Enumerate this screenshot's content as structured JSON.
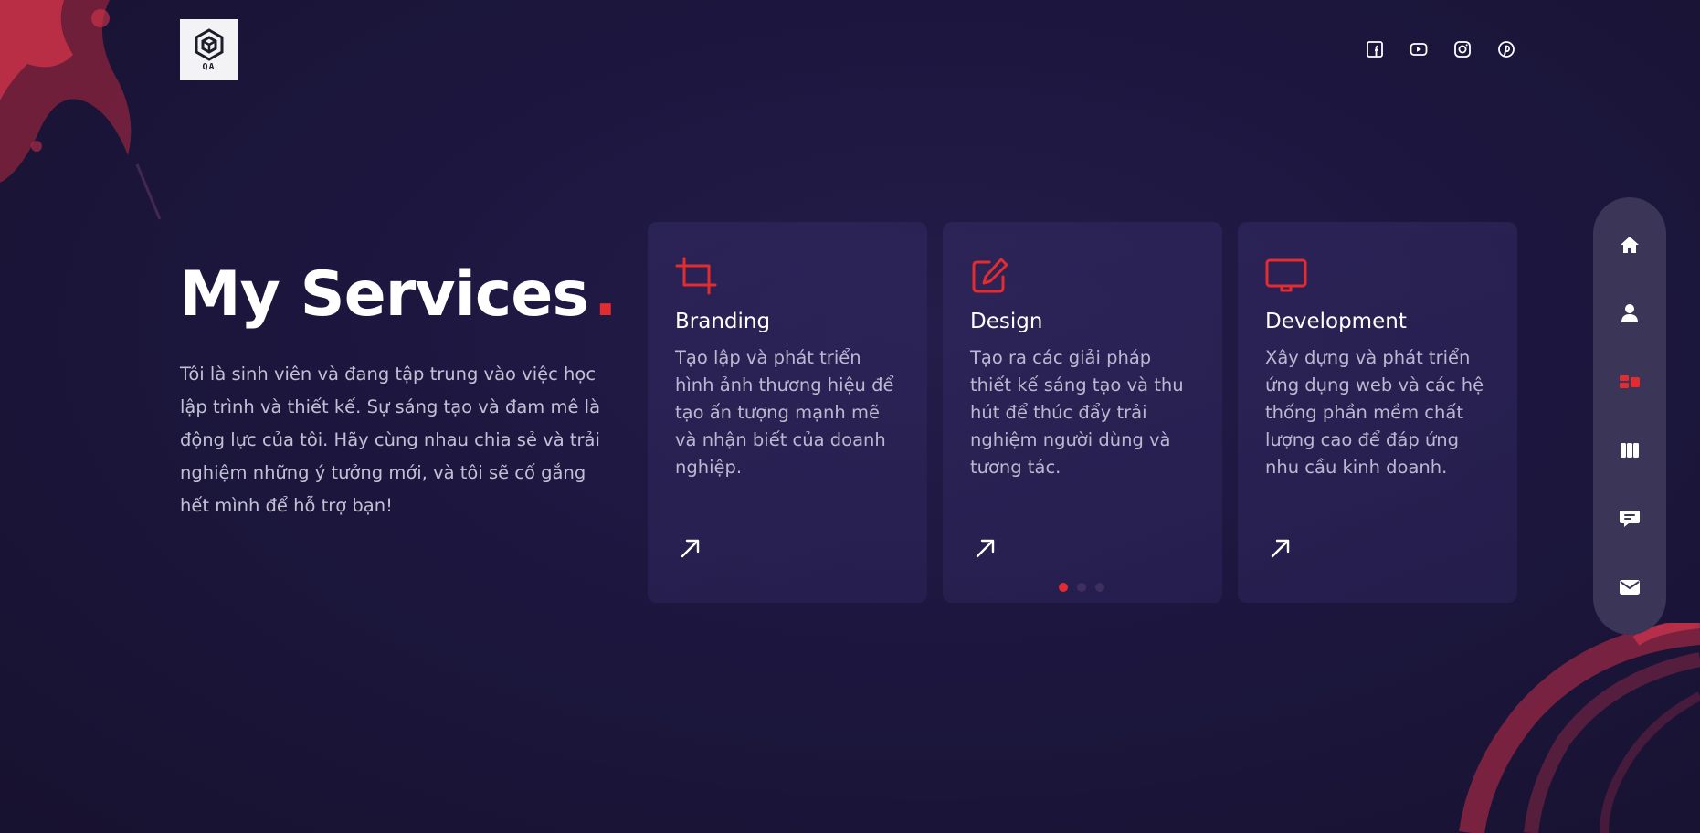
{
  "logo": {
    "text": "QA"
  },
  "social": [
    {
      "icon": "facebook-icon"
    },
    {
      "icon": "youtube-icon"
    },
    {
      "icon": "instagram-icon"
    },
    {
      "icon": "pinterest-icon"
    }
  ],
  "hero": {
    "title": "My Services",
    "title_dot": ".",
    "description": "Tôi là sinh viên và đang tập trung vào việc học lập trình và thiết kế. Sự sáng tạo và đam mê là động lực của tôi. Hãy cùng nhau chia sẻ và trải nghiệm những ý tưởng mới, và tôi sẽ cố gắng hết mình để hỗ trợ bạn!"
  },
  "services": [
    {
      "icon": "crop-icon",
      "title": "Branding",
      "description": "Tạo lập và phát triển hình ảnh thương hiệu để tạo ấn tượng mạnh mẽ và nhận biết của doanh nghiệp."
    },
    {
      "icon": "edit-icon",
      "title": "Design",
      "description": "Tạo ra các giải pháp thiết kế sáng tạo và thu hút để thúc đẩy trải nghiệm người dùng và tương tác."
    },
    {
      "icon": "monitor-icon",
      "title": "Development",
      "description": "Xây dựng và phát triển ứng dụng web và các hệ thống phần mềm chất lượng cao để đáp ứng nhu cầu kinh doanh."
    }
  ],
  "pagination": {
    "total": 3,
    "active": 1
  },
  "side_nav": [
    {
      "icon": "home-icon",
      "active": false
    },
    {
      "icon": "user-icon",
      "active": false
    },
    {
      "icon": "services-icon",
      "active": true
    },
    {
      "icon": "portfolio-icon",
      "active": false
    },
    {
      "icon": "chat-icon",
      "active": false
    },
    {
      "icon": "mail-icon",
      "active": false
    }
  ],
  "colors": {
    "accent": "#e32c2f",
    "background": "#1d1740",
    "card": "#2e2658",
    "nav": "#3b3558",
    "text_muted": "#c4c0d4"
  }
}
